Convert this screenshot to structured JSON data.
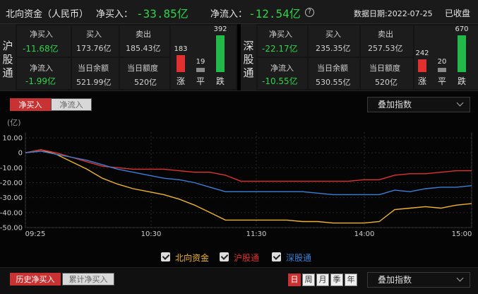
{
  "header": {
    "title": "北向资金（人民币）",
    "net_buy_label": "净买入：",
    "net_buy_value": "-33.85亿",
    "net_inflow_label": "净流入：",
    "net_inflow_value": "-12.54亿",
    "help_icon": "?",
    "date_label": "数据日期:2022-07-25",
    "status": "已收盘"
  },
  "shanghai": {
    "label": "沪股通",
    "net_buy_label": "净买入",
    "net_buy_value": "-11.68亿",
    "buy_label": "买入",
    "buy_value": "173.76亿",
    "sell_label": "卖出",
    "sell_value": "185.43亿",
    "net_inflow_label": "净流入",
    "net_inflow_value": "-1.99亿",
    "balance_label": "当日余额",
    "balance_value": "521.99亿",
    "quota_label": "当日额度",
    "quota_value": "520亿",
    "up_count": "183",
    "flat_count": "19",
    "down_count": "392",
    "up_label": "涨",
    "flat_label": "平",
    "down_label": "跌"
  },
  "shenzhen": {
    "label": "深股通",
    "net_buy_label": "净买入",
    "net_buy_value": "-22.17亿",
    "buy_label": "买入",
    "buy_value": "235.35亿",
    "sell_label": "卖出",
    "sell_value": "257.53亿",
    "net_inflow_label": "净流入",
    "net_inflow_value": "-10.55亿",
    "balance_label": "当日余额",
    "balance_value": "530.55亿",
    "quota_label": "当日额度",
    "quota_value": "520亿",
    "up_count": "242",
    "flat_count": "20",
    "down_count": "670",
    "up_label": "涨",
    "flat_label": "平",
    "down_label": "跌"
  },
  "chart_controls": {
    "tab_net_buy": "净买入",
    "tab_net_inflow": "净流入",
    "overlay_dropdown": "叠加指数",
    "unit": "(亿)"
  },
  "chart_data": {
    "type": "line",
    "ylim": [
      -50,
      10
    ],
    "y_ticks": [
      "10.00",
      "0",
      "-10.00",
      "-20.00",
      "-30.00",
      "-40.00",
      "-50.00"
    ],
    "x_ticks": [
      "09:25",
      "10:30",
      "11:30",
      "14:00",
      "15:00"
    ],
    "x_points": 30,
    "series": [
      {
        "name": "北向资金",
        "color": "#f0b429",
        "values": [
          0,
          2,
          -1,
          -6,
          -11,
          -17,
          -21,
          -24,
          -26,
          -28,
          -31,
          -35,
          -40,
          -45,
          -45,
          -45,
          -45,
          -45,
          -46,
          -46,
          -47,
          -47,
          -47,
          -46,
          -38,
          -37,
          -36,
          -37,
          -35,
          -34
        ]
      },
      {
        "name": "沪股通",
        "color": "#e03030",
        "values": [
          0,
          2,
          0,
          -3,
          -6,
          -9,
          -10,
          -11,
          -11,
          -11,
          -12,
          -13,
          -13,
          -15,
          -19,
          -19,
          -19,
          -19,
          -19,
          -19,
          -19,
          -19,
          -18,
          -18,
          -15,
          -14,
          -14,
          -13,
          -12,
          -12
        ]
      },
      {
        "name": "深股通",
        "color": "#3b7fd8",
        "values": [
          0,
          1,
          -1,
          -3,
          -5,
          -8,
          -11,
          -13,
          -15,
          -17,
          -18,
          -20,
          -23,
          -26,
          -26,
          -26,
          -26,
          -26,
          -26,
          -27,
          -28,
          -28,
          -28,
          -28,
          -25,
          -26,
          -24,
          -23,
          -23,
          -22
        ]
      }
    ]
  },
  "legend": [
    {
      "label": "北向资金",
      "color": "#f0b429"
    },
    {
      "label": "沪股通",
      "color": "#e03030"
    },
    {
      "label": "深股通",
      "color": "#3b7fd8"
    }
  ],
  "bottom": {
    "tab_history": "历史净买入",
    "tab_cumulative": "累计净买入",
    "periods": [
      "日",
      "周",
      "月",
      "季",
      "年"
    ],
    "overlay_dropdown": "叠加指数"
  }
}
